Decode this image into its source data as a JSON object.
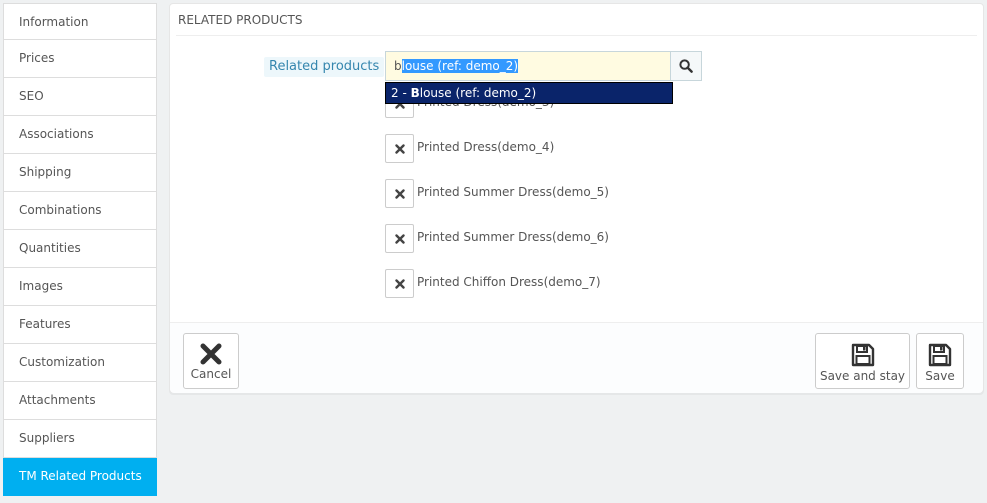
{
  "sidebar": {
    "tabs": [
      {
        "label": "Information"
      },
      {
        "label": "Prices"
      },
      {
        "label": "SEO"
      },
      {
        "label": "Associations"
      },
      {
        "label": "Shipping"
      },
      {
        "label": "Combinations"
      },
      {
        "label": "Quantities"
      },
      {
        "label": "Images"
      },
      {
        "label": "Features"
      },
      {
        "label": "Customization"
      },
      {
        "label": "Attachments"
      },
      {
        "label": "Suppliers"
      },
      {
        "label": "TM Related Products"
      }
    ],
    "active_index": 12,
    "active_color": "#00aff0"
  },
  "panel": {
    "heading": "RELATED PRODUCTS",
    "field_label": "Related products",
    "search": {
      "typed": "b",
      "autocomplete_selection": "louse (ref: demo_2)",
      "button_icon": "search-icon"
    },
    "autocomplete": {
      "prefix": "2 - ",
      "match": "B",
      "rest": "louse (ref: demo_2)"
    },
    "related_items": [
      {
        "name": "Printed Dress(demo_3)"
      },
      {
        "name": "Printed Dress(demo_4)"
      },
      {
        "name": "Printed Summer Dress(demo_5)"
      },
      {
        "name": "Printed Summer Dress(demo_6)"
      },
      {
        "name": "Printed Chiffon Dress(demo_7)"
      }
    ],
    "footer": {
      "cancel_label": "Cancel",
      "save_stay_label": "Save and stay",
      "save_label": "Save"
    }
  }
}
